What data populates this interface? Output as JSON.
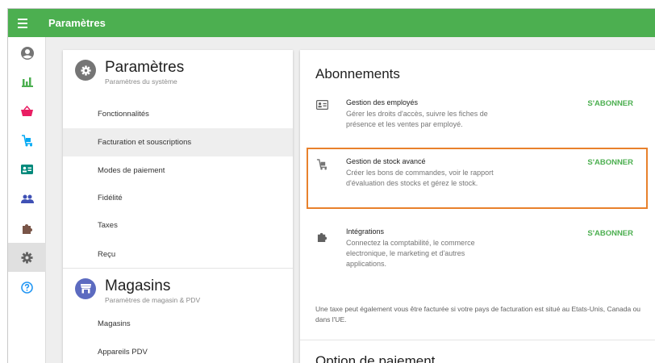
{
  "topbar": {
    "title": "Paramètres",
    "color": "#4caf50"
  },
  "sidebar": {
    "items": [
      {
        "name": "account-icon",
        "color": "#757575"
      },
      {
        "name": "reports-icon",
        "color": "#4caf50"
      },
      {
        "name": "sales-basket-icon",
        "color": "#e91e63"
      },
      {
        "name": "inventory-trolley-icon",
        "color": "#03a9f4"
      },
      {
        "name": "employees-card-icon",
        "color": "#00897b"
      },
      {
        "name": "customers-icon",
        "color": "#3f51b5"
      },
      {
        "name": "integrations-puzzle-icon",
        "color": "#795548"
      },
      {
        "name": "settings-gear-icon",
        "color": "#616161",
        "active": true
      },
      {
        "name": "help-icon",
        "color": "#2196f3"
      }
    ]
  },
  "settings_section": {
    "title": "Paramètres",
    "subtitle": "Paramètres du système",
    "icon": "gear-icon",
    "icon_color": "#757575",
    "items": [
      {
        "label": "Fonctionnalités"
      },
      {
        "label": "Facturation et souscriptions",
        "active": true
      },
      {
        "label": "Modes de paiement"
      },
      {
        "label": "Fidélité"
      },
      {
        "label": "Taxes"
      },
      {
        "label": "Reçu"
      }
    ]
  },
  "stores_section": {
    "title": "Magasins",
    "subtitle": "Paramètres de magasin & PDV",
    "icon": "store-icon",
    "icon_color": "#5c6bc0",
    "items": [
      {
        "label": "Magasins"
      },
      {
        "label": "Appareils PDV"
      }
    ]
  },
  "subscriptions": {
    "title": "Abonnements",
    "items": [
      {
        "name": "Gestion des employés",
        "description": "Gérer les droits d'accès, suivre les fiches de présence et les ventes par employé.",
        "button": "S'ABONNER",
        "icon": "id-card-icon"
      },
      {
        "name": "Gestion de stock avancé",
        "description": "Créer les bons de commandes, voir le rapport d'évaluation des stocks et gérez le stock.",
        "button": "S'ABONNER",
        "icon": "inventory-trolley-icon",
        "highlighted": true
      },
      {
        "name": "Intégrations",
        "description": "Connectez la comptabilité, le commerce electronique, le marketing et d'autres applications.",
        "button": "S'ABONNER",
        "icon": "puzzle-icon"
      }
    ],
    "tax_note": "Une taxe peut également vous être facturée si votre pays de facturation est situé au Etats-Unis, Canada ou dans l'UE.",
    "accent_color": "#4caf50",
    "highlight_color": "#e8812c"
  },
  "payment_option": {
    "title": "Option de paiement"
  }
}
